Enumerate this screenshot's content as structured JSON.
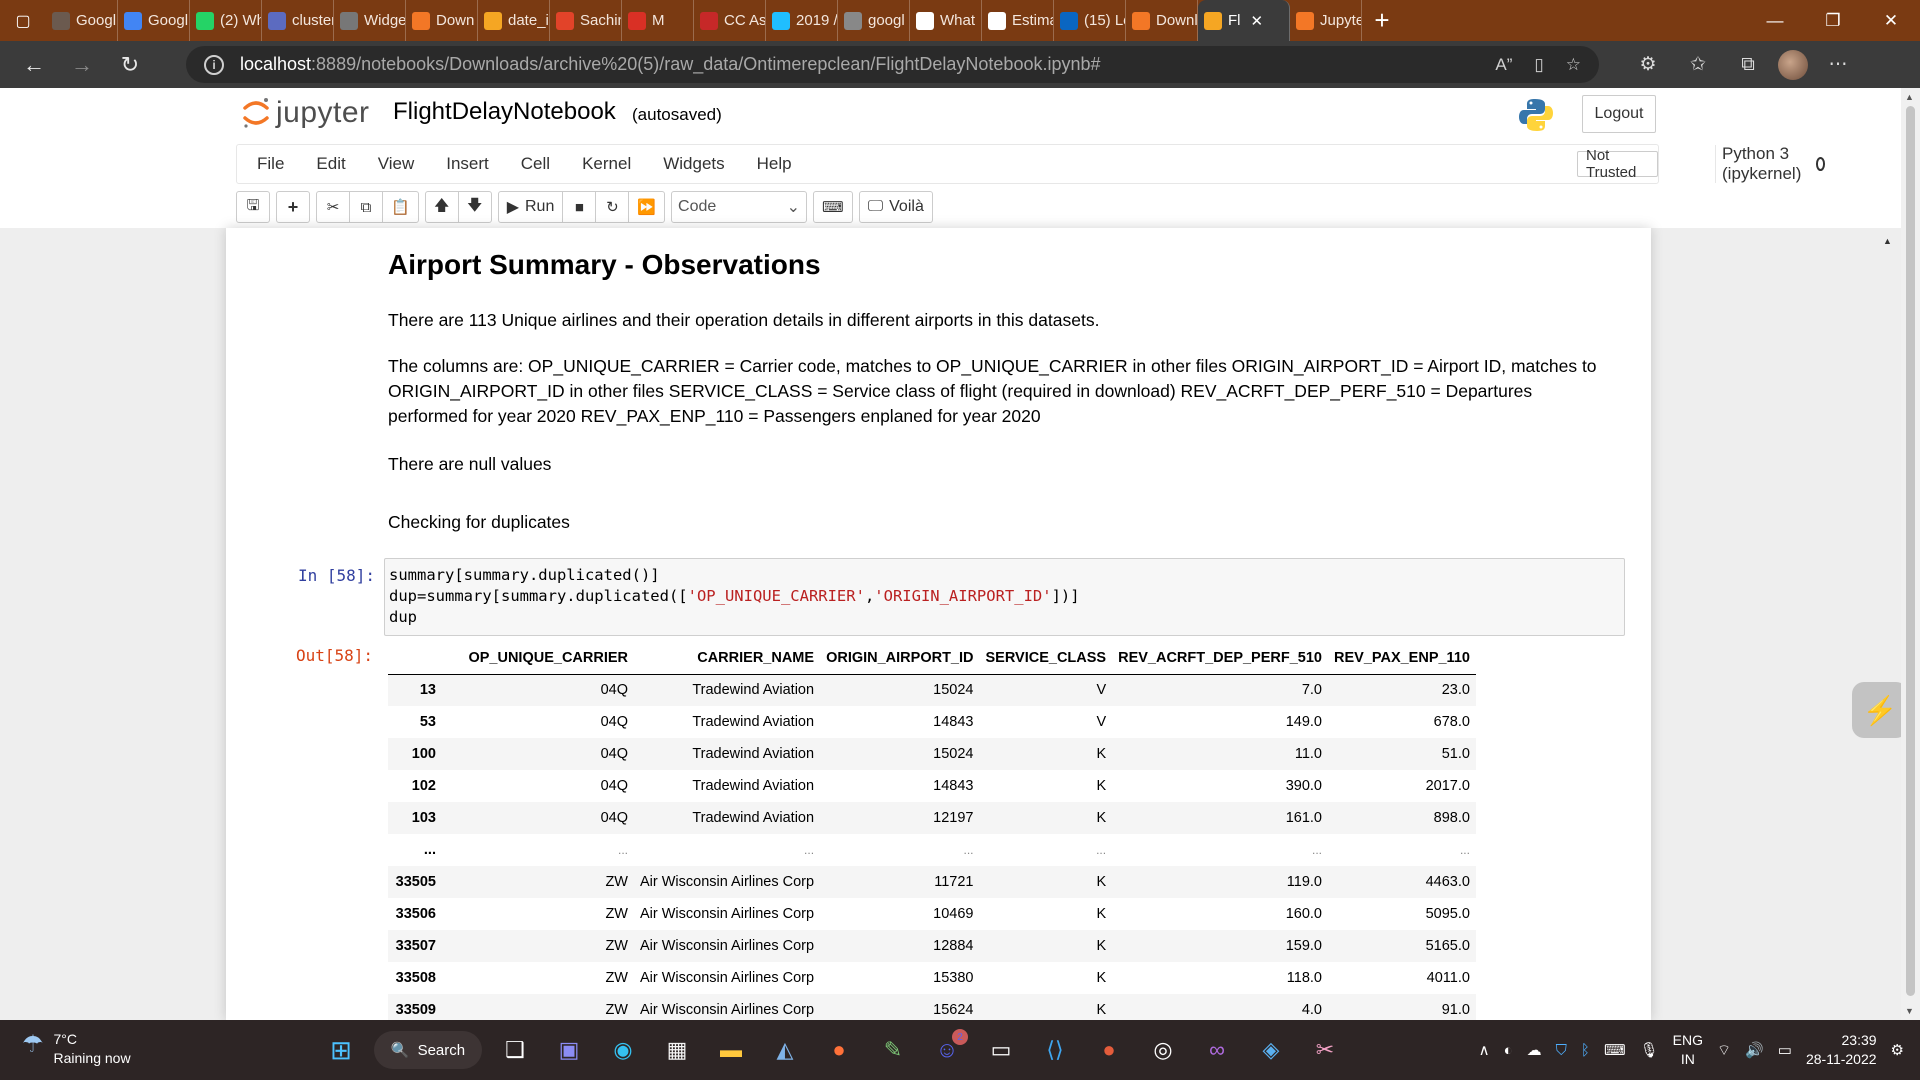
{
  "browser": {
    "tabs": [
      {
        "label": "Googl",
        "color": "#6b5a4f",
        "icon": "generic-icon"
      },
      {
        "label": "Googl",
        "color": "#4285f4",
        "icon": "docs-icon"
      },
      {
        "label": "(2) Wh",
        "color": "#25d366",
        "icon": "whatsapp-icon"
      },
      {
        "label": "cluster",
        "color": "#5c6bc0",
        "icon": "globe-icon"
      },
      {
        "label": "Widge",
        "color": "#777777",
        "icon": "page-icon"
      },
      {
        "label": "Down",
        "color": "#f37726",
        "icon": "jupyter-icon"
      },
      {
        "label": "date_i",
        "color": "#f5a623",
        "icon": "notebook-icon"
      },
      {
        "label": "Sachin",
        "color": "#e24329",
        "icon": "gitlab-icon"
      },
      {
        "label": "M",
        "color": "#d93025",
        "icon": "record-icon"
      },
      {
        "label": "CC As",
        "color": "#c62828",
        "icon": "pdf-icon"
      },
      {
        "label": "2019 /",
        "color": "#20beff",
        "icon": "kaggle-icon"
      },
      {
        "label": "googl",
        "color": "#888888",
        "icon": "search-icon"
      },
      {
        "label": "What",
        "color": "#ffffff",
        "icon": "grammarly-icon"
      },
      {
        "label": "Estima",
        "color": "#ffffff",
        "icon": "page-icon"
      },
      {
        "label": "(15) Le",
        "color": "#0a66c2",
        "icon": "linkedin-icon"
      },
      {
        "label": "Downl",
        "color": "#f37726",
        "icon": "jupyter-icon"
      },
      {
        "label": "Fl",
        "color": "#f5a623",
        "icon": "notebook-icon",
        "active": true
      },
      {
        "label": "Jupyte",
        "color": "#f37726",
        "icon": "jupyter-icon"
      }
    ],
    "url_host": "localhost",
    "url_rest": ":8889/notebooks/Downloads/archive%20(5)/raw_data/Ontimerepclean/FlightDelayNotebook.ipynb#"
  },
  "jupyter": {
    "logo_text": "jupyter",
    "notebook_title": "FlightDelayNotebook",
    "autosave_status": "(autosaved)",
    "logout_label": "Logout",
    "menu": [
      "File",
      "Edit",
      "View",
      "Insert",
      "Cell",
      "Kernel",
      "Widgets",
      "Help"
    ],
    "trust_status": "Not Trusted",
    "kernel_name": "Python 3 (ipykernel)",
    "toolbar": {
      "run_label": "Run",
      "cell_type": "Code",
      "voila_label": "Voilà"
    }
  },
  "notebook": {
    "heading": "Airport Summary - Observations",
    "para1": "There are 113 Unique airlines and their operation details in different airports in this datasets.",
    "para2": "The columns are: OP_UNIQUE_CARRIER = Carrier code, matches to OP_UNIQUE_CARRIER in other files ORIGIN_AIRPORT_ID = Airport ID, matches to ORIGIN_AIRPORT_ID in other files SERVICE_CLASS = Service class of flight (required in download) REV_ACRFT_DEP_PERF_510 = Departures performed for year 2020 REV_PAX_ENP_110 = Passengers enplaned for year 2020",
    "para3": "There are null values",
    "para4": "Checking for duplicates",
    "in_prompt": "In [58]:",
    "out_prompt": "Out[58]:",
    "code_line1": "summary[summary.duplicated()]",
    "code_line2_pre": "dup=summary[summary.duplicated([",
    "code_line2_str1": "'OP_UNIQUE_CARRIER'",
    "code_line2_sep": ",",
    "code_line2_str2": "'ORIGIN_AIRPORT_ID'",
    "code_line2_post": "])]",
    "code_line3": "dup",
    "table": {
      "columns": [
        "",
        "OP_UNIQUE_CARRIER",
        "CARRIER_NAME",
        "ORIGIN_AIRPORT_ID",
        "SERVICE_CLASS",
        "REV_ACRFT_DEP_PERF_510",
        "REV_PAX_ENP_110"
      ],
      "rows": [
        [
          "13",
          "04Q",
          "Tradewind Aviation",
          "15024",
          "V",
          "7.0",
          "23.0"
        ],
        [
          "53",
          "04Q",
          "Tradewind Aviation",
          "14843",
          "V",
          "149.0",
          "678.0"
        ],
        [
          "100",
          "04Q",
          "Tradewind Aviation",
          "15024",
          "K",
          "11.0",
          "51.0"
        ],
        [
          "102",
          "04Q",
          "Tradewind Aviation",
          "14843",
          "K",
          "390.0",
          "2017.0"
        ],
        [
          "103",
          "04Q",
          "Tradewind Aviation",
          "12197",
          "K",
          "161.0",
          "898.0"
        ],
        [
          "...",
          "...",
          "...",
          "...",
          "...",
          "...",
          "..."
        ],
        [
          "33505",
          "ZW",
          "Air Wisconsin Airlines Corp",
          "11721",
          "K",
          "119.0",
          "4463.0"
        ],
        [
          "33506",
          "ZW",
          "Air Wisconsin Airlines Corp",
          "10469",
          "K",
          "160.0",
          "5095.0"
        ],
        [
          "33507",
          "ZW",
          "Air Wisconsin Airlines Corp",
          "12884",
          "K",
          "159.0",
          "5165.0"
        ],
        [
          "33508",
          "ZW",
          "Air Wisconsin Airlines Corp",
          "15380",
          "K",
          "118.0",
          "4011.0"
        ],
        [
          "33509",
          "ZW",
          "Air Wisconsin Airlines Corp",
          "15624",
          "K",
          "4.0",
          "91.0"
        ]
      ]
    }
  },
  "taskbar": {
    "weather_temp": "7°C",
    "weather_desc": "Raining now",
    "search_label": "Search",
    "discord_badge": "2",
    "lang_line1": "ENG",
    "lang_line2": "IN",
    "time": "23:39",
    "date": "28-11-2022"
  },
  "colors": {
    "tab_strip": "#7a3a12",
    "jupyter_orange": "#f37726",
    "in_prompt": "#303f9f",
    "out_prompt": "#d84315",
    "code_string": "#ba2121"
  }
}
